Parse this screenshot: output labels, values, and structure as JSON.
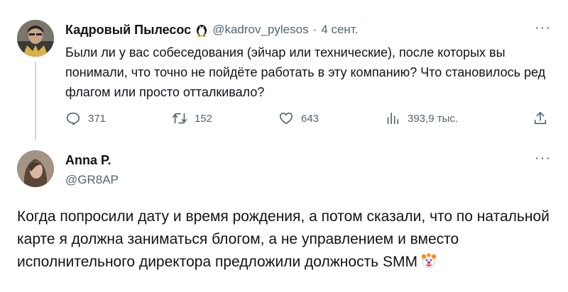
{
  "tweet1": {
    "author_name": "Кадровый Пылесос",
    "handle": "@kadrov_pylesos",
    "separator": "·",
    "date": "4 сент.",
    "text": "Были ли у вас собеседования (эйчар или технические), после которых вы понимали, что точно не пойдёте работать в эту компанию? Что становилось ред флагом или просто отталкивало?",
    "replies": "371",
    "retweets": "152",
    "likes": "643",
    "views": "393,9 тыс.",
    "more_label": "···"
  },
  "tweet2": {
    "author_name": "Anna P.",
    "handle": "@GR8AP",
    "text": "Когда попросили дату и время рождения, а потом сказали, что по натальной карте я должна заниматься блогом, а не управлением и вместо исполнительного директора предложили должность SMM",
    "emoji_icon": "clown-face-icon",
    "more_label": "···"
  },
  "colors": {
    "text": "#0f1419",
    "secondary": "#536471",
    "thread_line": "#cfd9de"
  }
}
